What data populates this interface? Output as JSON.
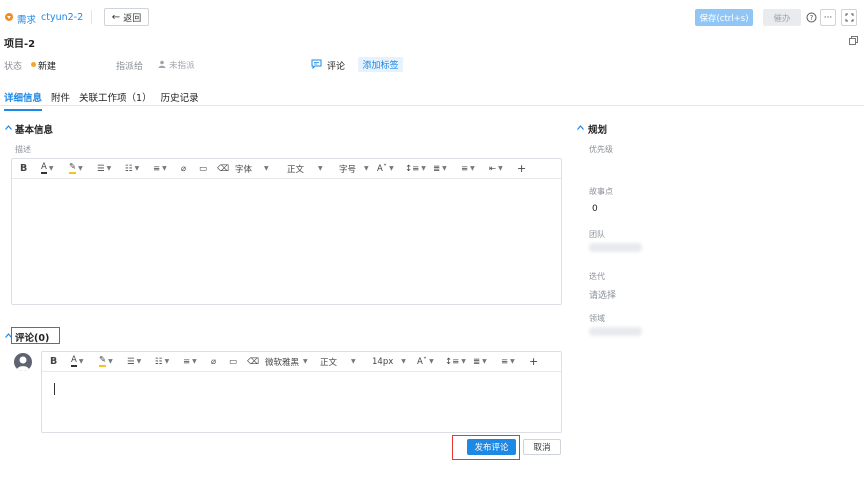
{
  "header": {
    "type_label": "需求",
    "item_id": "ctyun2-2",
    "back_label": "返回",
    "save_label": "保存(ctrl+s)",
    "urge_label": "催办",
    "more_label": "···",
    "title": "项目-2"
  },
  "meta": {
    "status_label": "状态",
    "status_value": "新建",
    "status_color": "#f5a623",
    "assignee_label": "指派给",
    "assignee_value": "未指派",
    "comment_label": "评论",
    "add_tag_label": "添加标签"
  },
  "tabs": [
    {
      "label": "详细信息",
      "active": true
    },
    {
      "label": "附件",
      "active": false
    },
    {
      "label": "关联工作项（1）",
      "active": false
    },
    {
      "label": "历史记录",
      "active": false
    }
  ],
  "basic_info": {
    "title": "基本信息",
    "desc_label": "描述",
    "toolbar": {
      "font": "字体",
      "paragraph": "正文",
      "size": "字号"
    }
  },
  "planning": {
    "title": "规划",
    "priority_label": "优先级",
    "story_points_label": "故事点",
    "story_points_value": "0",
    "team_label": "团队",
    "iteration_label": "迭代",
    "iteration_placeholder": "请选择",
    "domain_label": "领域"
  },
  "comments": {
    "title": "评论(0)",
    "toolbar": {
      "font": "微软雅黑",
      "paragraph": "正文",
      "size": "14px"
    },
    "publish_label": "发布评论",
    "cancel_label": "取消"
  },
  "colors": {
    "accent": "#1e88e5",
    "highlight": "#e53935"
  }
}
